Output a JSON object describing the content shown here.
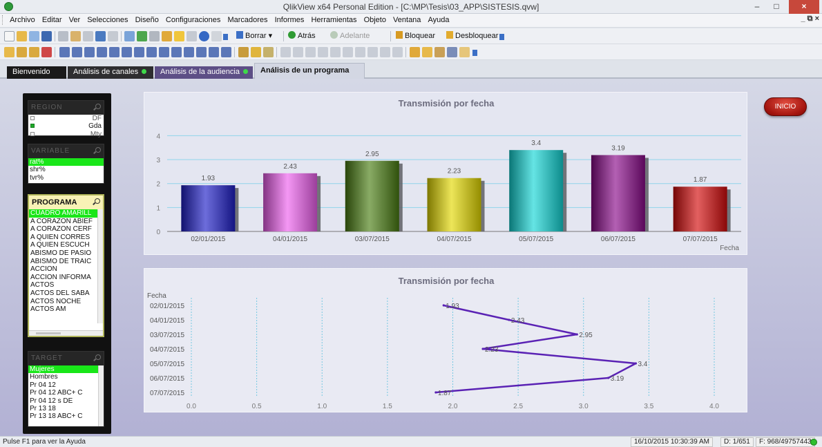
{
  "window": {
    "title": "QlikView x64 Personal Edition - [C:\\MP\\Tesis\\03_APP\\SISTESIS.qvw]",
    "minimize": "–",
    "restore": "□",
    "close": "×"
  },
  "menu": {
    "items": [
      "Archivo",
      "Editar",
      "Ver",
      "Selecciones",
      "Diseño",
      "Configuraciones",
      "Marcadores",
      "Informes",
      "Herramientas",
      "Objeto",
      "Ventana",
      "Ayuda"
    ],
    "mdi_controls": "_ ⧉ ×"
  },
  "toolbar": {
    "borrar": "Borrar ▾",
    "atras": "Atrás",
    "adelante": "Adelante",
    "bloquear": "Bloquear",
    "desbloquear": "Desbloquear"
  },
  "tabs": [
    {
      "label": "Bienvenido",
      "active": false
    },
    {
      "label": "Análisis de canales",
      "active": false
    },
    {
      "label": "Análisis de la audiencia",
      "active": false
    },
    {
      "label": "Análisis de un programa",
      "active": true
    }
  ],
  "listboxes": {
    "region": {
      "title": "REGION",
      "items": [
        {
          "label": "DF",
          "selected": false
        },
        {
          "label": "Gda",
          "selected": true
        },
        {
          "label": "Mty",
          "selected": false
        }
      ]
    },
    "variable": {
      "title": "VARIABLE",
      "items": [
        "rat%",
        "shr%",
        "tvr%"
      ],
      "selected": "rat%"
    },
    "programa": {
      "title": "PROGRAMA",
      "items": [
        "CUADRO AMARILL",
        "A CORAZON ABIEF",
        "A CORAZON CERF",
        "A QUIEN CORRES",
        "A QUIEN ESCUCH",
        "ABISMO DE PASIO",
        "ABISMO DE TRAIC",
        "ACCION",
        "ACCION INFORMA",
        "ACTOS",
        "ACTOS  DEL SABA",
        "ACTOS  NOCHE",
        "ACTOS AM"
      ],
      "selected": "CUADRO AMARILL"
    },
    "target": {
      "title": "TARGET",
      "items": [
        "Mujeres",
        "Hombres",
        "Pr 04 12",
        "Pr 04 12 ABC+ C",
        "Pr 04 12 s DE",
        "Pr 13 18",
        "Pr 13 18 ABC+ C"
      ],
      "selected": "Mujeres"
    }
  },
  "buttons": {
    "inicio": "INICIO"
  },
  "chart_data": [
    {
      "type": "bar",
      "title": "Transmisión por fecha",
      "xlabel": "Fecha",
      "ylabel": "",
      "categories": [
        "02/01/2015",
        "04/01/2015",
        "03/07/2015",
        "04/07/2015",
        "05/07/2015",
        "06/07/2015",
        "07/07/2015"
      ],
      "values": [
        1.93,
        2.43,
        2.95,
        2.23,
        3.4,
        3.19,
        1.87
      ],
      "colors": [
        "#1f1fc8",
        "#ee5fee",
        "#4a7d12",
        "#e3d900",
        "#12d6d6",
        "#8a0a8a",
        "#d40b0b"
      ],
      "ylim": [
        0,
        4.3
      ],
      "yticks": [
        0,
        1,
        2,
        3,
        4
      ],
      "grid": true,
      "legend": "none"
    },
    {
      "type": "line",
      "title": "Transmisión por fecha",
      "ylabel": "Fecha",
      "categories": [
        "02/01/2015",
        "04/01/2015",
        "03/07/2015",
        "04/07/2015",
        "05/07/2015",
        "06/07/2015",
        "07/07/2015"
      ],
      "values": [
        1.93,
        2.43,
        2.95,
        2.23,
        3.4,
        3.19,
        1.87
      ],
      "xlim": [
        0,
        4.0
      ],
      "xticks": [
        "0.0",
        "0.5",
        "1.0",
        "1.5",
        "2.0",
        "2.5",
        "3.0",
        "3.5",
        "4.0"
      ],
      "line_color": "#5a22b4",
      "grid": true,
      "legend": "none"
    }
  ],
  "status": {
    "help": "Pulse F1 para ver la Ayuda",
    "timestamp": "16/10/2015 10:30:39 AM",
    "d": "D: 1/651",
    "f": "F: 968/49757443"
  }
}
